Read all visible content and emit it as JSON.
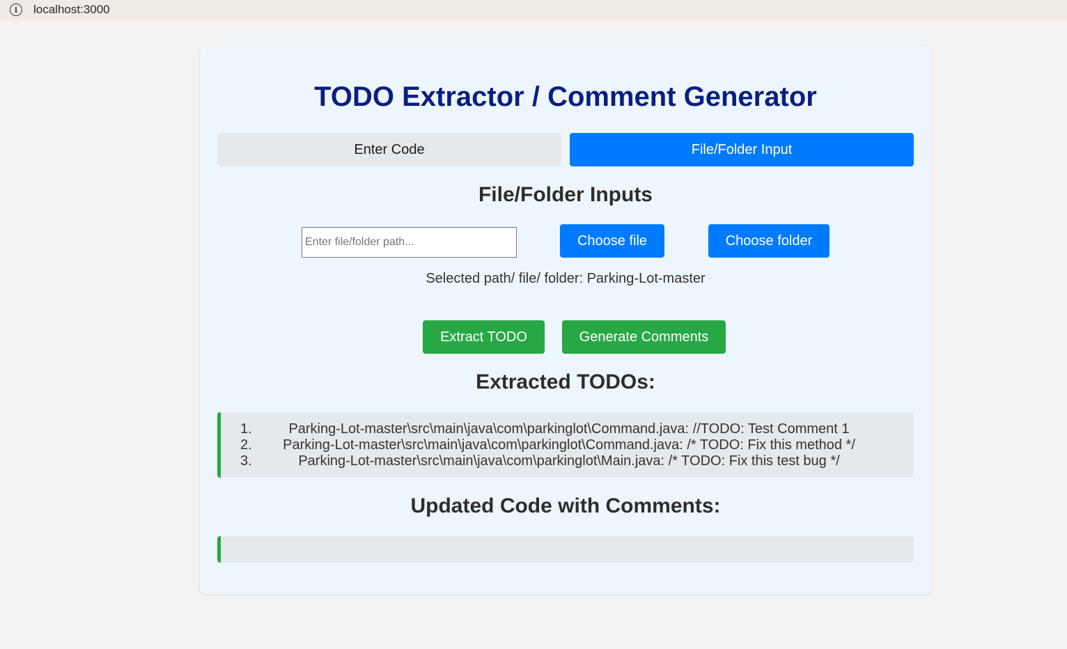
{
  "browser": {
    "url": "localhost:3000",
    "info_icon": "info-icon"
  },
  "app": {
    "title": "TODO Extractor / Comment Generator",
    "tabs": [
      {
        "label": "Enter Code",
        "active": false
      },
      {
        "label": "File/Folder Input",
        "active": true
      }
    ]
  },
  "file_section": {
    "heading": "File/Folder Inputs",
    "path_input": {
      "value": "",
      "placeholder": "Enter file/folder path..."
    },
    "choose_file_label": "Choose file",
    "choose_folder_label": "Choose folder",
    "selected_path_text": "Selected path/ file/ folder: Parking-Lot-master"
  },
  "actions": {
    "extract_label": "Extract TODO",
    "generate_label": "Generate Comments"
  },
  "todos_section": {
    "heading": "Extracted TODOs:",
    "items": [
      {
        "num": "1.",
        "text": "Parking-Lot-master\\src\\main\\java\\com\\parkinglot\\Command.java: //TODO: Test Comment 1"
      },
      {
        "num": "2.",
        "text": "Parking-Lot-master\\src\\main\\java\\com\\parkinglot\\Command.java: /* TODO: Fix this method */"
      },
      {
        "num": "3.",
        "text": "Parking-Lot-master\\src\\main\\java\\com\\parkinglot\\Main.java: /* TODO: Fix this test bug */"
      }
    ]
  },
  "comments_section": {
    "heading": "Updated Code with Comments:",
    "content": ""
  },
  "colors": {
    "primary": "#007bff",
    "success": "#28a745",
    "title": "#0b1e80",
    "card_bg": "#eef6fd"
  }
}
